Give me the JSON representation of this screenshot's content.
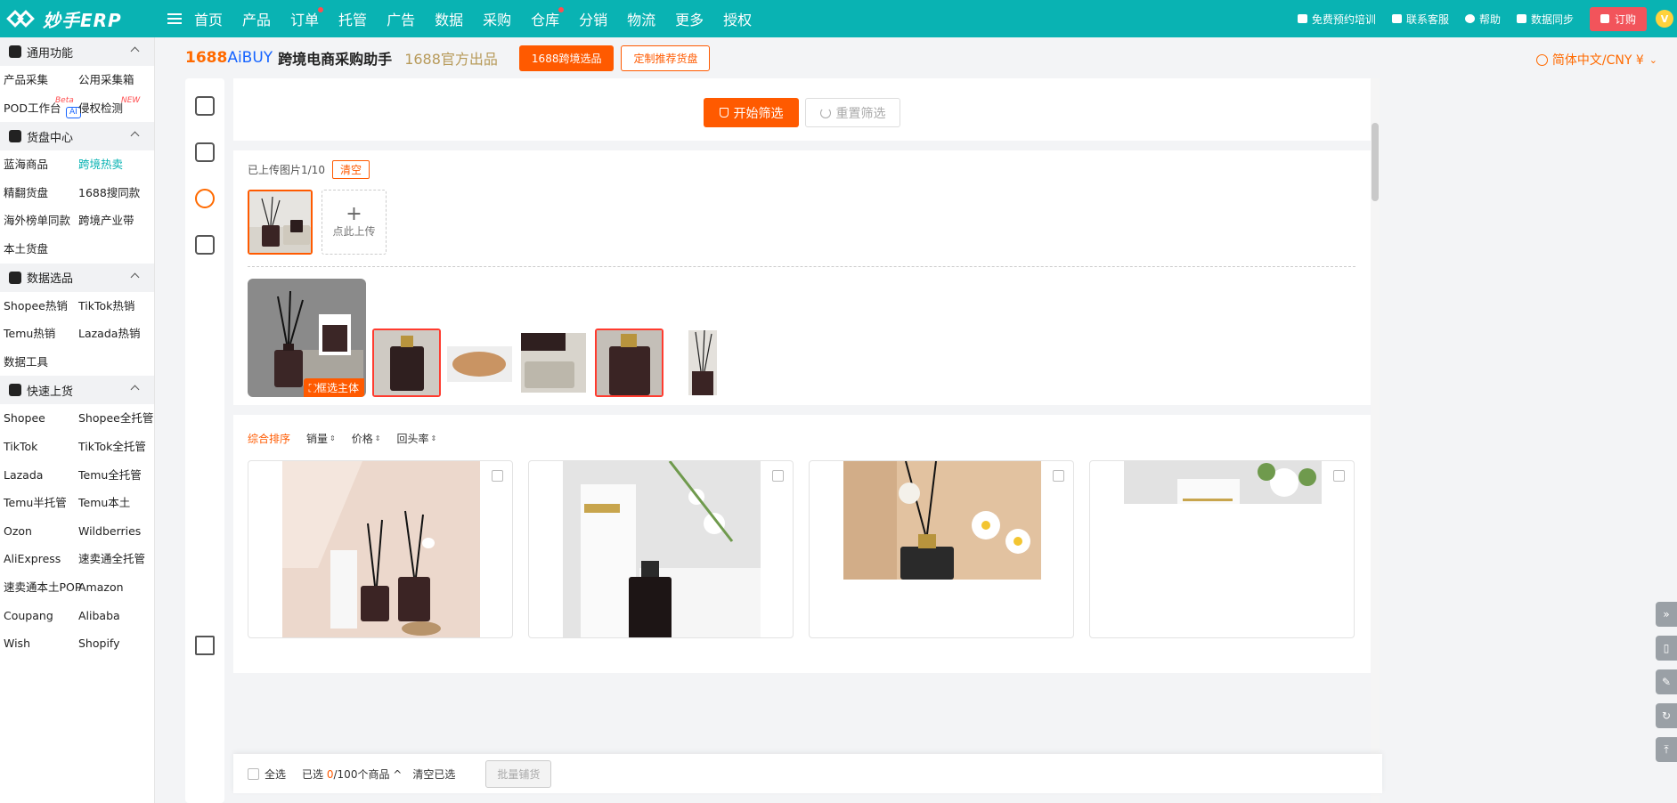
{
  "topbar": {
    "logo_text": "妙手ERP",
    "nav": [
      {
        "label": "首页",
        "dot": false
      },
      {
        "label": "产品",
        "dot": false
      },
      {
        "label": "订单",
        "dot": true
      },
      {
        "label": "托管",
        "dot": false
      },
      {
        "label": "广告",
        "dot": false
      },
      {
        "label": "数据",
        "dot": false
      },
      {
        "label": "采购",
        "dot": false
      },
      {
        "label": "仓库",
        "dot": true
      },
      {
        "label": "分销",
        "dot": false
      },
      {
        "label": "物流",
        "dot": false
      },
      {
        "label": "更多",
        "dot": false
      },
      {
        "label": "授权",
        "dot": false
      }
    ],
    "right_links": [
      "免费预约培训",
      "联系客服",
      "帮助",
      "数据同步"
    ],
    "order_label": "订购",
    "vip_label": "V"
  },
  "sidebar": {
    "sections": [
      {
        "title": "通用功能",
        "items": [
          "产品采集",
          "公用采集箱",
          "POD工作台",
          "侵权检测"
        ]
      },
      {
        "title": "货盘中心",
        "items": [
          "蓝海商品",
          "跨境热卖",
          "精翻货盘",
          "1688搜同款",
          "海外榜单同款",
          "跨境产业带",
          "本土货盘"
        ]
      },
      {
        "title": "数据选品",
        "items": [
          "Shopee热销",
          "TikTok热销",
          "Temu热销",
          "Lazada热销",
          "数据工具"
        ]
      },
      {
        "title": "快速上货",
        "items": [
          "Shopee",
          "Shopee全托管",
          "TikTok",
          "TikTok全托管",
          "Lazada",
          "Temu全托管",
          "Temu半托管",
          "Temu本土",
          "Ozon",
          "Wildberries",
          "AliExpress",
          "速卖通全托管",
          "速卖通本土POP",
          "Amazon",
          "Coupang",
          "Alibaba",
          "Wish",
          "Shopify"
        ]
      }
    ],
    "badges": {
      "beta": "Beta",
      "new": "NEW",
      "ai": "AI"
    },
    "active_item": "跨境热卖"
  },
  "header": {
    "brand_1688": "1688",
    "brand_aibuy": "AiBUY",
    "title": "跨境电商采购助手",
    "official": "1688官方出品",
    "btn_primary": "1688跨境选品",
    "btn_secondary": "定制推荐货盘",
    "language": "简体中文/CNY ¥"
  },
  "filter": {
    "start_label": "开始筛选",
    "reset_label": "重置筛选"
  },
  "upload": {
    "label": "已上传图片1/10",
    "clear_label": "清空",
    "upload_slot_label": "点此上传",
    "frame_subject_label": "框选主体"
  },
  "sort": {
    "options": [
      "综合排序",
      "销量",
      "价格",
      "回头率"
    ],
    "active": "综合排序"
  },
  "bottom": {
    "select_all": "全选",
    "selected_prefix": "已选",
    "selected_count": "0",
    "selected_suffix": "/100个商品",
    "clear_selected": "清空已选",
    "batch_label": "批量铺货"
  },
  "colors": {
    "teal": "#09b3b3",
    "orange": "#ff5a00",
    "red": "#f2545b"
  }
}
